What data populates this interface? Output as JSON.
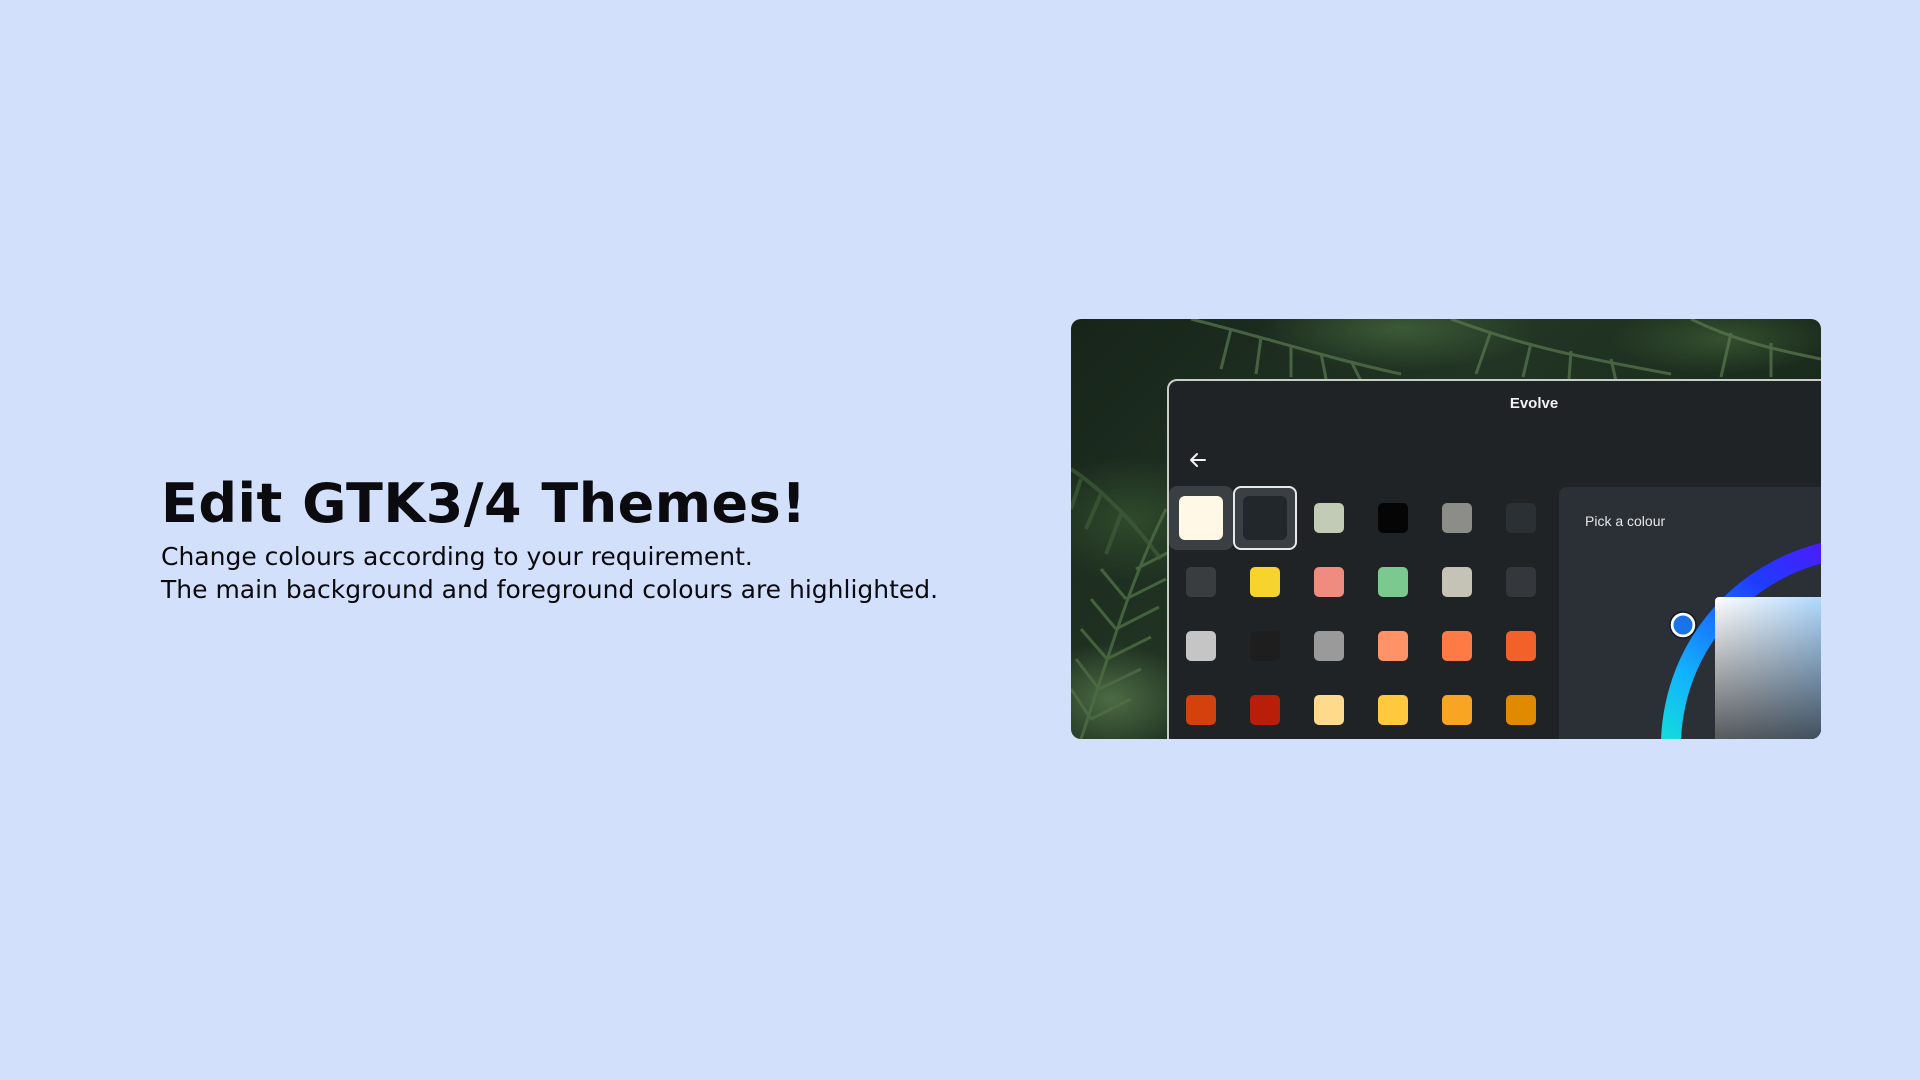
{
  "hero": {
    "title": "Edit GTK3/4 Themes!",
    "line1": "Change colours according to your requirement.",
    "line2": "The main background and foreground colours are highlighted."
  },
  "window": {
    "title": "Evolve",
    "back_icon": "arrow-left-icon",
    "picker_label": "Pick a colour"
  },
  "swatches": [
    "#fff8e6",
    "#22272b",
    "#c2cbb6",
    "#050505",
    "#8c8c88",
    "#2b3035",
    "#3a3d40",
    "#f6d32d",
    "#f08b80",
    "#7cc98f",
    "#c5c2b6",
    "#34383c",
    "#c5c5c5",
    "#1e1e1e",
    "#9a9a9a",
    "#ff9266",
    "#ff7a45",
    "#f2612a",
    "#d4410d",
    "#b81e0a",
    "#ffd98c",
    "#ffc83d",
    "#f8a523",
    "#e08a00"
  ],
  "colors": {
    "page_bg": "#d2e0fb",
    "selected_handle": "#1a73e8"
  }
}
